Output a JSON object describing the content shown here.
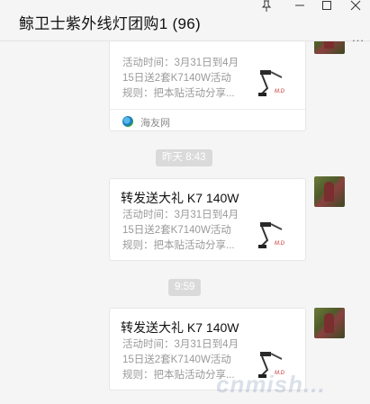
{
  "window": {
    "title": "鲸卫士紫外线灯团购1 (96)",
    "pin_icon": "pin-icon",
    "minimize_icon": "minimize-icon",
    "maximize_icon": "maximize-icon",
    "close_icon": "close-icon",
    "more_label": "..."
  },
  "messages": [
    {
      "type": "link-card",
      "title": "",
      "desc_lines": [
        "活动时间：3月31日到4月",
        "15日送2套K7140W活动",
        "规则：把本贴活动分享..."
      ],
      "source": "海友网",
      "thumb_mark": "M.D"
    },
    {
      "type": "time",
      "label": "昨天 8:43"
    },
    {
      "type": "link-card",
      "title": "转发送大礼 K7 140W",
      "desc_lines": [
        "活动时间：3月31日到4月",
        "15日送2套K7140W活动",
        "规则：把本贴活动分享..."
      ],
      "source": "",
      "thumb_mark": "M.D"
    },
    {
      "type": "time",
      "label": "9:59"
    },
    {
      "type": "link-card",
      "title": "转发送大礼 K7 140W",
      "desc_lines": [
        "活动时间：3月31日到4月",
        "15日送2套K7140W活动",
        "规则：把本贴活动分享..."
      ],
      "source": "",
      "thumb_mark": "M.D"
    }
  ],
  "watermark": "cnmish..."
}
